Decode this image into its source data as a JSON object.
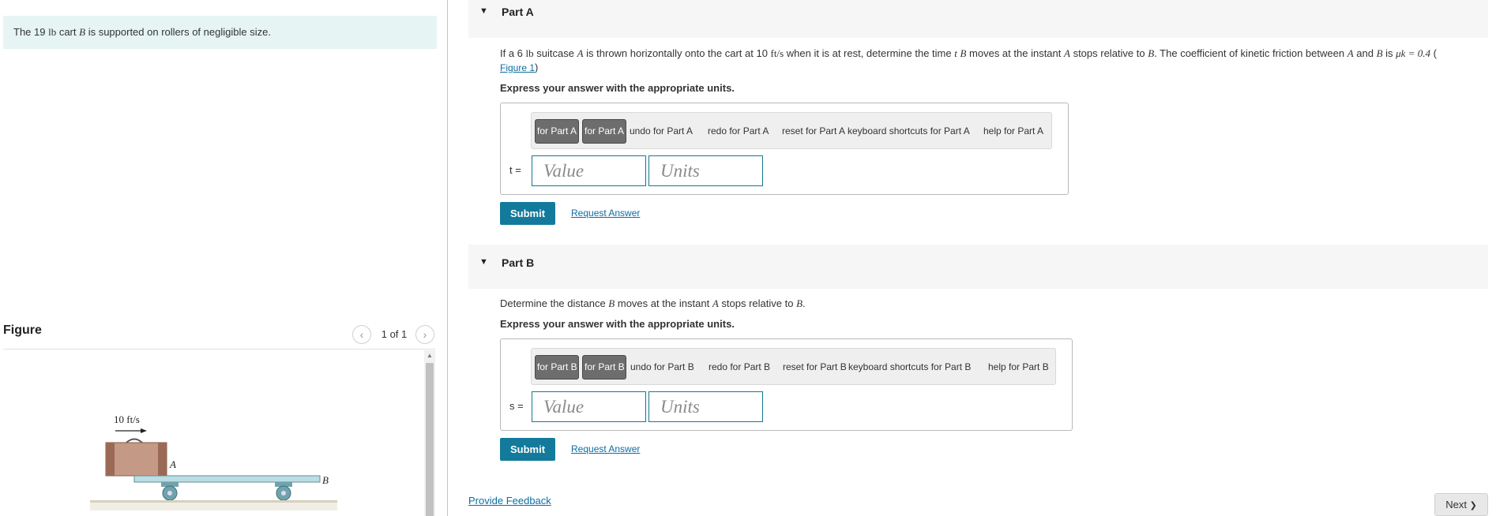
{
  "intro": {
    "text_before": "The 19 ",
    "unit_lb": "lb",
    "text_mid": " cart ",
    "var_B": "B",
    "text_after": " is supported on rollers of negligible size."
  },
  "figure": {
    "heading": "Figure",
    "counter": "1 of 1",
    "prev_glyph": "‹",
    "next_glyph": "›",
    "velocity_label": "10 ft/s",
    "label_A": "A",
    "label_B": "B",
    "colors": {
      "suitcase": "#c49a86",
      "suitcase_edge": "#8a5a48",
      "cart": "#bcdde3",
      "wheel": "#6fa3ad"
    }
  },
  "partA": {
    "title": "Part A",
    "question": {
      "p1": "If a 6 ",
      "lb": "lb",
      "p2": " suitcase ",
      "A": "A",
      "p3": " is thrown horizontally onto the cart at 10 ",
      "speed_unit": "ft/s",
      "p4": " when it is at rest, determine the time ",
      "t": "t",
      "p5": " ",
      "B": "B",
      "p6": " moves at the instant ",
      "A2": "A",
      "p7": " stops relative to ",
      "B2": "B",
      "p8": ". The coefficient of kinetic friction between ",
      "A3": "A",
      "p9": " and ",
      "B3": "B",
      "p10": " is ",
      "mu": "μk = 0.4",
      "p11": " ("
    },
    "figure_link": "Figure 1",
    "figure_link_close": ")",
    "units_note": "Express your answer with the appropriate units.",
    "toolbar": {
      "btn1": "for Part A",
      "btn2": "for Part A",
      "undo": "undo for Part A",
      "redo": "redo for Part A",
      "reset": "reset for Part A",
      "shortcuts": "keyboard shortcuts for Part A",
      "help": "help for Part A"
    },
    "var_label": "t =",
    "value_placeholder": "Value",
    "units_placeholder": "Units",
    "submit": "Submit",
    "request": "Request Answer"
  },
  "partB": {
    "title": "Part B",
    "question": {
      "p1": "Determine the distance ",
      "B": "B",
      "p2": " moves at the instant ",
      "A": "A",
      "p3": " stops relative to ",
      "B2": "B",
      "p4": "."
    },
    "units_note": "Express your answer with the appropriate units.",
    "toolbar": {
      "btn1": "for Part B",
      "btn2": "for Part B",
      "undo": "undo for Part B",
      "redo": "redo for Part B",
      "reset": "reset for Part B",
      "shortcuts": "keyboard shortcuts for Part B",
      "help": "help for Part B"
    },
    "var_label": "s =",
    "value_placeholder": "Value",
    "units_placeholder": "Units",
    "submit": "Submit",
    "request": "Request Answer"
  },
  "footer": {
    "feedback": "Provide Feedback",
    "next": "Next",
    "next_glyph": "❯"
  }
}
